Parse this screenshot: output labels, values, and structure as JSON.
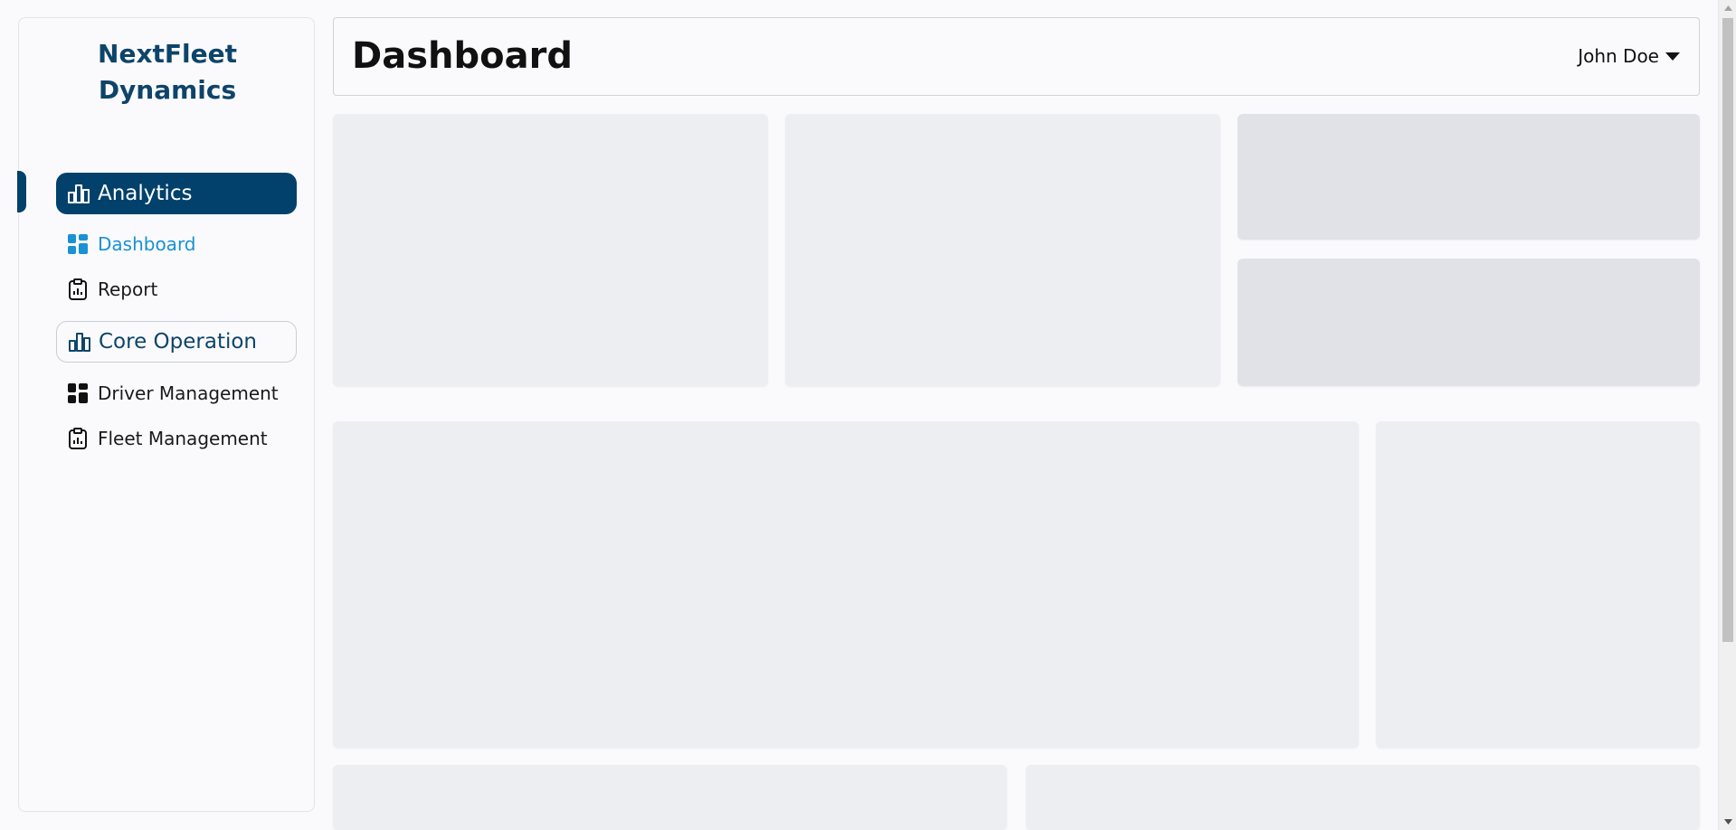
{
  "brand": {
    "line1": "NextFleet",
    "line2": "Dynamics",
    "color": "#0e4469"
  },
  "sidebar": {
    "sections": [
      {
        "label": "Analytics",
        "icon": "bar-chart-icon",
        "active": true,
        "items": [
          {
            "label": "Dashboard",
            "icon": "grid-icon",
            "selected": true
          },
          {
            "label": "Report",
            "icon": "clipboard-chart-icon",
            "selected": false
          }
        ]
      },
      {
        "label": "Core Operation",
        "icon": "bar-chart-icon",
        "active": false,
        "items": [
          {
            "label": "Driver Management",
            "icon": "grid-icon",
            "selected": false
          },
          {
            "label": "Fleet Management",
            "icon": "clipboard-chart-icon",
            "selected": false
          }
        ]
      }
    ]
  },
  "header": {
    "title": "Dashboard",
    "user": {
      "name": "John Doe",
      "icon": "caret-down-icon"
    }
  },
  "colors": {
    "accent": "#01416b",
    "selected": "#1991d4",
    "card": "#edeef2",
    "card_dark": "#e0e2e8"
  }
}
